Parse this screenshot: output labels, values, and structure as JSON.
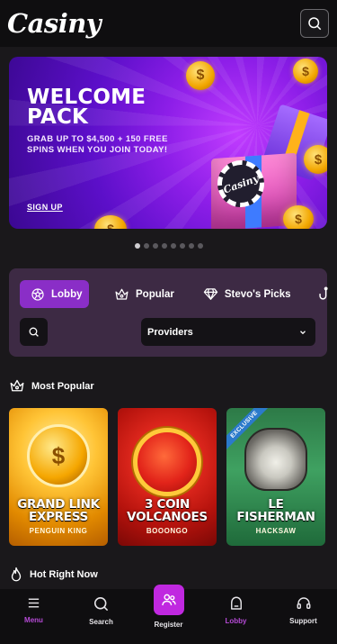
{
  "header": {
    "logo_text": "Casiny",
    "search_icon": "search-icon"
  },
  "banner": {
    "title_line1": "WELCOME",
    "title_line2": "PACK",
    "subtitle": "GRAB UP TO $4,500 + 150 FREE SPINS WHEN YOU JOIN TODAY!",
    "cta": "SIGN UP",
    "chip_text": "Casiny",
    "slides_total": 8,
    "active_slide": 1
  },
  "lobby": {
    "tabs": [
      {
        "label": "Lobby",
        "icon": "soccer-ball-icon",
        "active": true
      },
      {
        "label": "Popular",
        "icon": "crown-icon",
        "active": false
      },
      {
        "label": "Stevo's Picks",
        "icon": "diamond-icon",
        "active": false
      }
    ],
    "providers_label": "Providers"
  },
  "sections": {
    "most_popular": "Most Popular",
    "hot_right_now": "Hot Right Now"
  },
  "games": [
    {
      "title_line1": "GRAND LINK",
      "title_line2": "EXPRESS",
      "provider": "PENGUIN KING"
    },
    {
      "title_line1": "3 COIN",
      "title_line2": "VOLCANOES",
      "provider": "BOOONGO"
    },
    {
      "title_line1": "LE",
      "title_line2": "FISHERMAN",
      "provider": "HACKSAW",
      "badge": "EXCLUSIVE"
    }
  ],
  "nav": {
    "menu": "Menu",
    "search": "Search",
    "register": "Register",
    "lobby": "Lobby",
    "support": "Support"
  },
  "colors": {
    "accent": "#c028e0",
    "tab_active": "#8a2ec7",
    "panel": "#3d2a44",
    "background": "#1a181b"
  }
}
